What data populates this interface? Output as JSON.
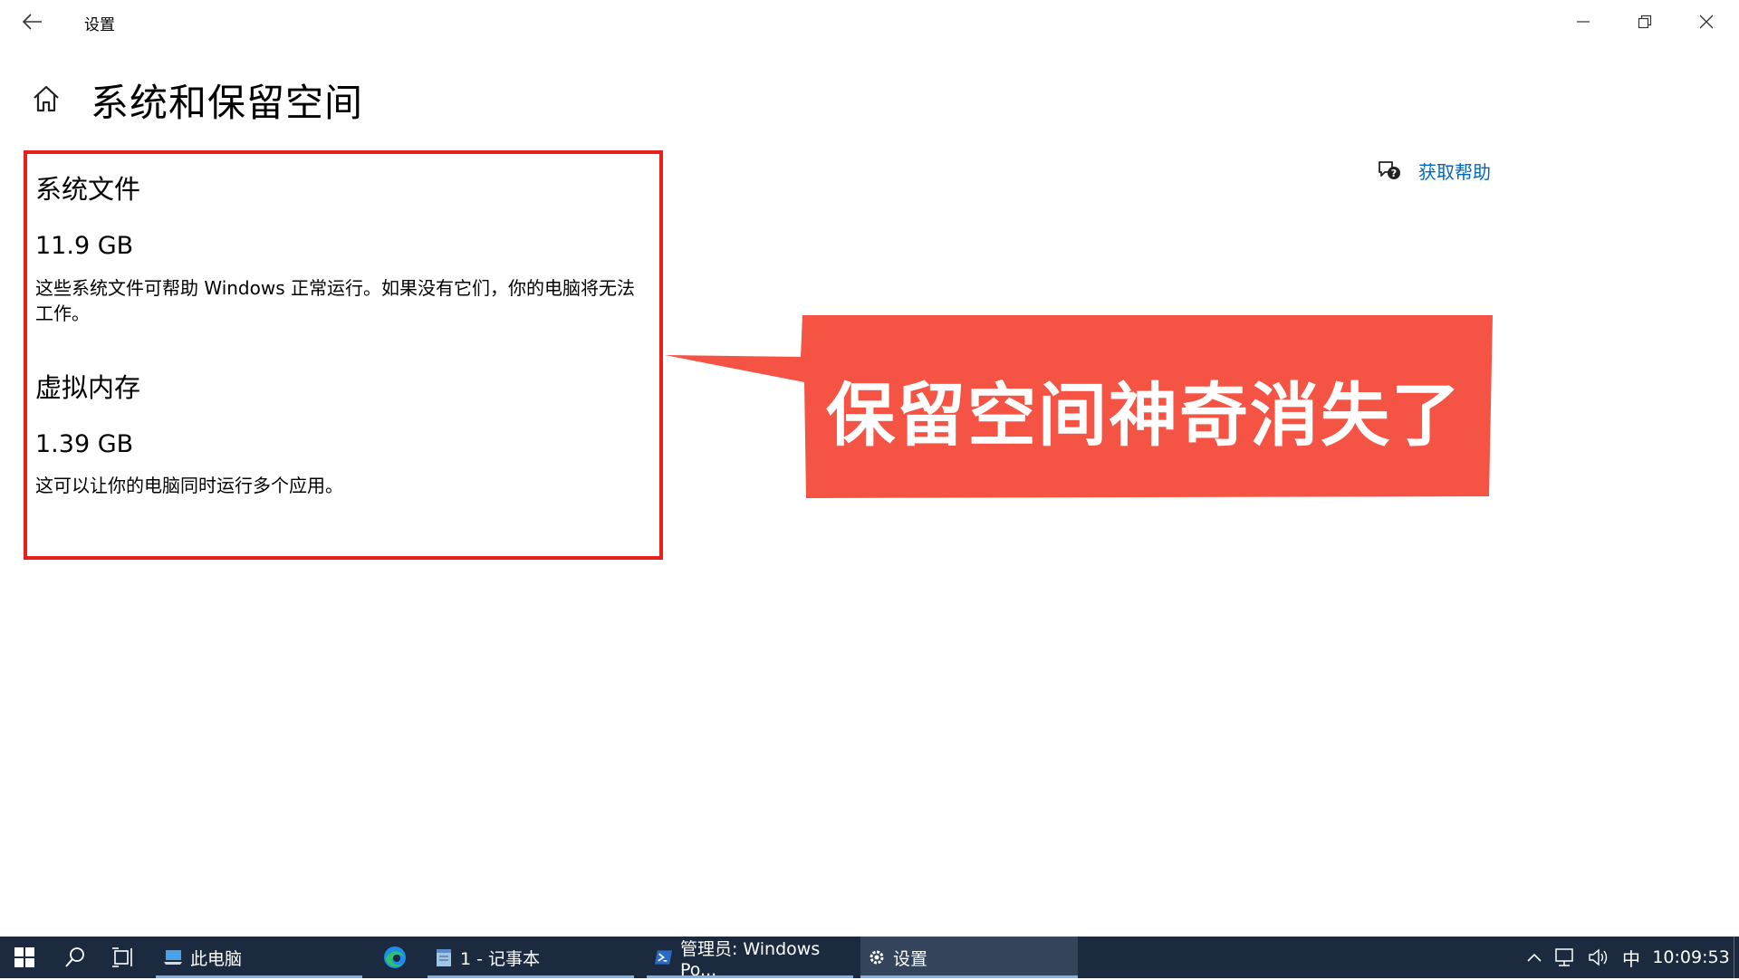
{
  "window": {
    "title": "设置"
  },
  "page": {
    "title": "系统和保留空间"
  },
  "sections": [
    {
      "heading": "系统文件",
      "size": "11.9 GB",
      "description": "这些系统文件可帮助 Windows 正常运行。如果没有它们，你的电脑将无法工作。"
    },
    {
      "heading": "虚拟内存",
      "size": "1.39 GB",
      "description": "这可以让你的电脑同时运行多个应用。"
    }
  ],
  "help": {
    "label": "获取帮助"
  },
  "callout": {
    "text": "保留空间神奇消失了",
    "color": "#f55445"
  },
  "taskbar": {
    "apps": [
      {
        "label": "此电脑",
        "icon": "computer-icon"
      },
      {
        "label": "",
        "icon": "edge-icon"
      },
      {
        "label": "1 - 记事本",
        "icon": "notepad-icon"
      },
      {
        "label": "管理员: Windows Po...",
        "icon": "powershell-icon"
      },
      {
        "label": "设置",
        "icon": "gear-icon"
      }
    ],
    "ime": "中",
    "time": "10:09:53"
  },
  "colors": {
    "highlight_border": "#e8201a",
    "link": "#0067c0",
    "taskbar": "#1b2a3f"
  }
}
